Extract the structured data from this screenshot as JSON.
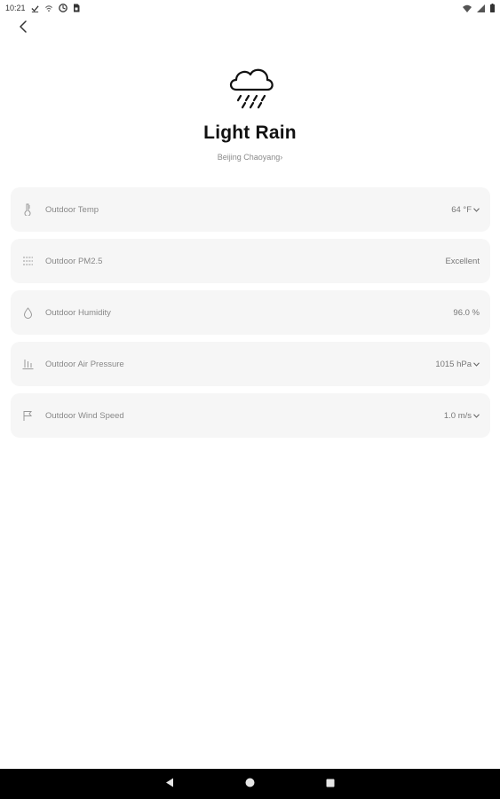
{
  "status_bar": {
    "time": "10:21",
    "left_icons": [
      "check-icon",
      "wifi-call-icon",
      "sync-icon",
      "sim-icon"
    ],
    "right_icons": [
      "wifi-icon",
      "signal-icon",
      "battery-icon"
    ]
  },
  "header": {
    "back_icon": "chevron-left-icon"
  },
  "weather": {
    "icon": "cloud-rain-icon",
    "condition": "Light Rain",
    "location": "Beijing Chaoyang",
    "location_arrow": "›"
  },
  "metrics": [
    {
      "icon": "thermometer-icon",
      "label": "Outdoor Temp",
      "value": "64 °F",
      "has_dropdown": true
    },
    {
      "icon": "pm25-icon",
      "label": "Outdoor PM2.5",
      "value": "Excellent",
      "has_dropdown": false
    },
    {
      "icon": "humidity-icon",
      "label": "Outdoor Humidity",
      "value": "96.0 %",
      "has_dropdown": false
    },
    {
      "icon": "pressure-icon",
      "label": "Outdoor Air Pressure",
      "value": "1015 hPa",
      "has_dropdown": true
    },
    {
      "icon": "wind-flag-icon",
      "label": "Outdoor Wind Speed",
      "value": "1.0 m/s",
      "has_dropdown": true
    }
  ],
  "nav_bar": {
    "back": "nav-back-icon",
    "home": "nav-home-icon",
    "recents": "nav-recents-icon"
  },
  "colors": {
    "card_bg": "#f6f6f6",
    "nav_bg": "#000000",
    "title": "#111111",
    "muted": "#888888"
  }
}
